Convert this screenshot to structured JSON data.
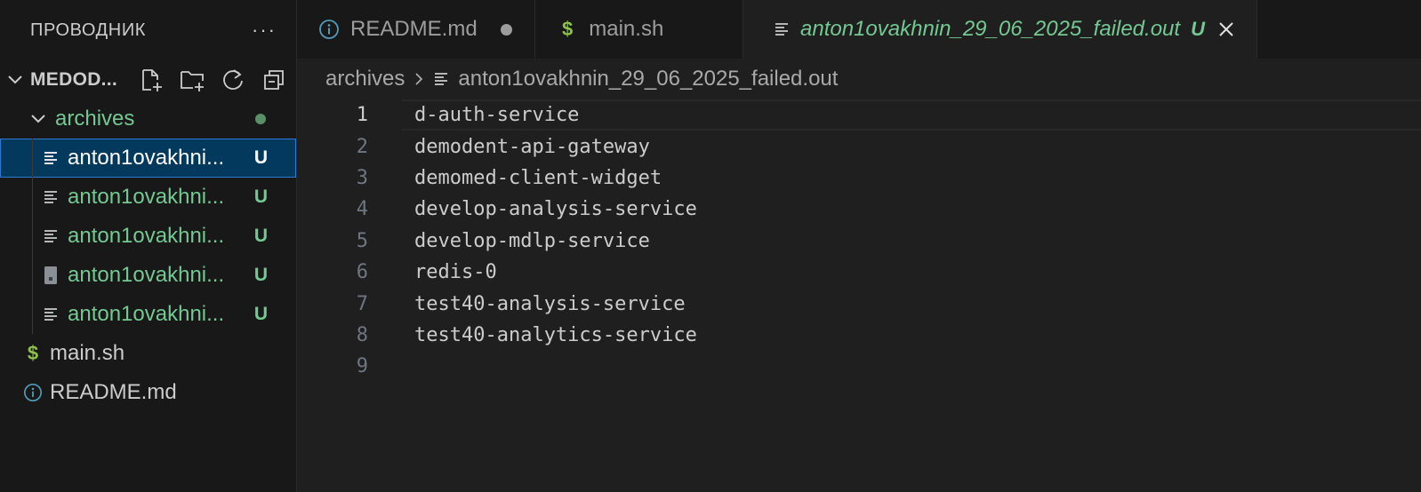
{
  "explorer": {
    "title": "ПРОВОДНИК",
    "more": "···",
    "project": "MEDOD...",
    "folder": {
      "name": "archives"
    },
    "files": [
      {
        "name": "anton1ovakhni...",
        "badge": "U",
        "icon": "lines-file-icon",
        "selected": true
      },
      {
        "name": "anton1ovakhni...",
        "badge": "U",
        "icon": "lines-file-icon",
        "selected": false
      },
      {
        "name": "anton1ovakhni...",
        "badge": "U",
        "icon": "lines-file-icon",
        "selected": false
      },
      {
        "name": "anton1ovakhni...",
        "badge": "U",
        "icon": "archive-file-icon",
        "selected": false
      },
      {
        "name": "anton1ovakhni...",
        "badge": "U",
        "icon": "lines-file-icon",
        "selected": false
      }
    ],
    "root_files": [
      {
        "name": "main.sh",
        "icon": "dollar-icon"
      },
      {
        "name": "README.md",
        "icon": "info-icon"
      }
    ]
  },
  "tabs": [
    {
      "label": "README.md",
      "icon": "info-icon",
      "modified": true
    },
    {
      "label": "main.sh",
      "icon": "dollar-icon"
    },
    {
      "label": "anton1ovakhnin_29_06_2025_failed.out",
      "icon": "lines-file-icon",
      "badge": "U",
      "active": true
    }
  ],
  "breadcrumb": {
    "folder": "archives",
    "file": "anton1ovakhnin_29_06_2025_failed.out"
  },
  "editor": {
    "current_line": 1,
    "lines": [
      {
        "n": "1",
        "text": "d-auth-service"
      },
      {
        "n": "2",
        "text": "demodent-api-gateway"
      },
      {
        "n": "3",
        "text": "demomed-client-widget"
      },
      {
        "n": "4",
        "text": "develop-analysis-service"
      },
      {
        "n": "5",
        "text": "develop-mdlp-service"
      },
      {
        "n": "6",
        "text": "redis-0"
      },
      {
        "n": "7",
        "text": "test40-analysis-service"
      },
      {
        "n": "8",
        "text": "test40-analytics-service"
      },
      {
        "n": "9",
        "text": ""
      }
    ]
  },
  "colors": {
    "untracked_green": "#73c991",
    "selection_bg": "#04395e",
    "selection_border": "#2b79d0",
    "dollar_green": "#8dc149",
    "info_blue": "#519aba"
  }
}
